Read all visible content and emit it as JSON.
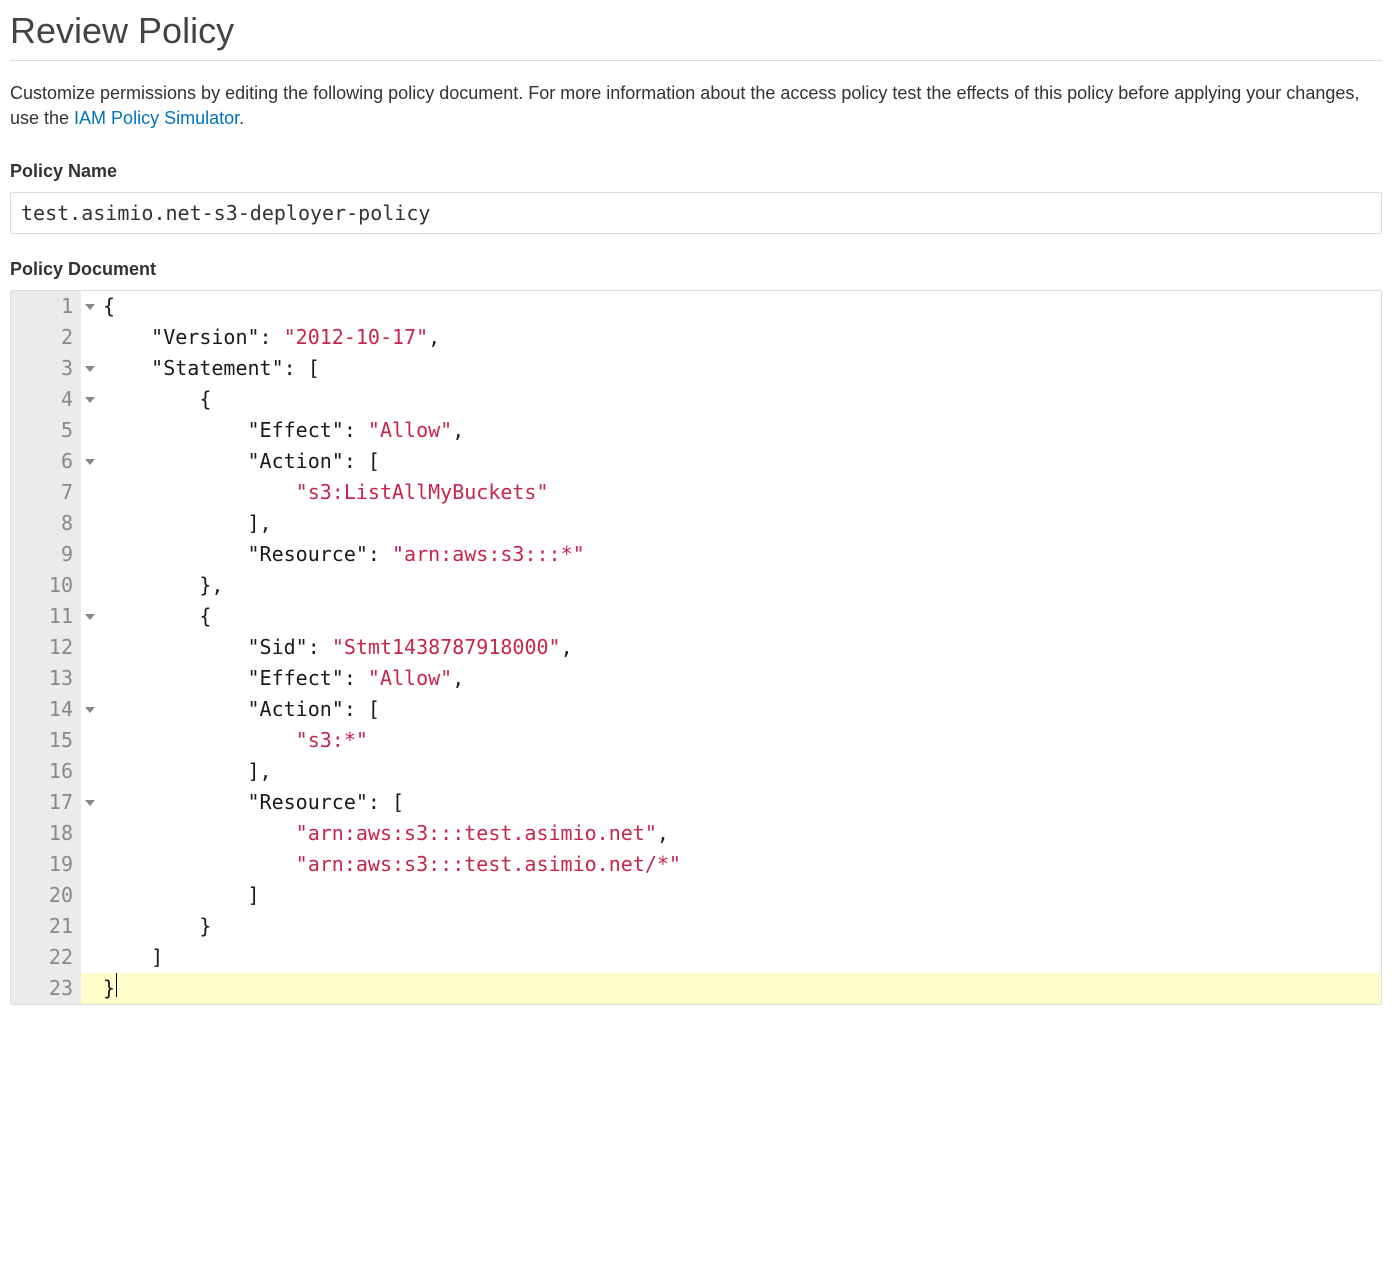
{
  "page": {
    "title": "Review Policy",
    "description_prefix": "Customize permissions by editing the following policy document. For more information about the access policy test the effects of this policy before applying your changes, use the ",
    "description_link_text": "IAM Policy Simulator",
    "description_suffix": "."
  },
  "labels": {
    "policy_name": "Policy Name",
    "policy_document": "Policy Document"
  },
  "form": {
    "policy_name_value": "test.asimio.net-s3-deployer-policy"
  },
  "editor": {
    "lines": [
      {
        "num": "1",
        "fold": true,
        "indent": 0,
        "tokens": [
          {
            "t": "punct",
            "v": "{"
          }
        ]
      },
      {
        "num": "2",
        "fold": false,
        "indent": 0,
        "tokens": [
          {
            "t": "text",
            "v": "    "
          },
          {
            "t": "key",
            "v": "\"Version\""
          },
          {
            "t": "punct",
            "v": ": "
          },
          {
            "t": "string",
            "v": "\"2012-10-17\""
          },
          {
            "t": "punct",
            "v": ","
          }
        ]
      },
      {
        "num": "3",
        "fold": true,
        "indent": 0,
        "tokens": [
          {
            "t": "text",
            "v": "    "
          },
          {
            "t": "key",
            "v": "\"Statement\""
          },
          {
            "t": "punct",
            "v": ": ["
          }
        ]
      },
      {
        "num": "4",
        "fold": true,
        "indent": 0,
        "tokens": [
          {
            "t": "text",
            "v": "        "
          },
          {
            "t": "punct",
            "v": "{"
          }
        ]
      },
      {
        "num": "5",
        "fold": false,
        "indent": 0,
        "tokens": [
          {
            "t": "text",
            "v": "            "
          },
          {
            "t": "key",
            "v": "\"Effect\""
          },
          {
            "t": "punct",
            "v": ": "
          },
          {
            "t": "string",
            "v": "\"Allow\""
          },
          {
            "t": "punct",
            "v": ","
          }
        ]
      },
      {
        "num": "6",
        "fold": true,
        "indent": 0,
        "tokens": [
          {
            "t": "text",
            "v": "            "
          },
          {
            "t": "key",
            "v": "\"Action\""
          },
          {
            "t": "punct",
            "v": ": ["
          }
        ]
      },
      {
        "num": "7",
        "fold": false,
        "indent": 0,
        "tokens": [
          {
            "t": "text",
            "v": "                "
          },
          {
            "t": "string",
            "v": "\"s3:ListAllMyBuckets\""
          }
        ]
      },
      {
        "num": "8",
        "fold": false,
        "indent": 0,
        "tokens": [
          {
            "t": "text",
            "v": "            "
          },
          {
            "t": "punct",
            "v": "],"
          }
        ]
      },
      {
        "num": "9",
        "fold": false,
        "indent": 0,
        "tokens": [
          {
            "t": "text",
            "v": "            "
          },
          {
            "t": "key",
            "v": "\"Resource\""
          },
          {
            "t": "punct",
            "v": ": "
          },
          {
            "t": "string",
            "v": "\"arn:aws:s3:::*\""
          }
        ]
      },
      {
        "num": "10",
        "fold": false,
        "indent": 0,
        "tokens": [
          {
            "t": "text",
            "v": "        "
          },
          {
            "t": "punct",
            "v": "},"
          }
        ]
      },
      {
        "num": "11",
        "fold": true,
        "indent": 0,
        "tokens": [
          {
            "t": "text",
            "v": "        "
          },
          {
            "t": "punct",
            "v": "{"
          }
        ]
      },
      {
        "num": "12",
        "fold": false,
        "indent": 0,
        "tokens": [
          {
            "t": "text",
            "v": "            "
          },
          {
            "t": "key",
            "v": "\"Sid\""
          },
          {
            "t": "punct",
            "v": ": "
          },
          {
            "t": "string",
            "v": "\"Stmt1438787918000\""
          },
          {
            "t": "punct",
            "v": ","
          }
        ]
      },
      {
        "num": "13",
        "fold": false,
        "indent": 0,
        "tokens": [
          {
            "t": "text",
            "v": "            "
          },
          {
            "t": "key",
            "v": "\"Effect\""
          },
          {
            "t": "punct",
            "v": ": "
          },
          {
            "t": "string",
            "v": "\"Allow\""
          },
          {
            "t": "punct",
            "v": ","
          }
        ]
      },
      {
        "num": "14",
        "fold": true,
        "indent": 0,
        "tokens": [
          {
            "t": "text",
            "v": "            "
          },
          {
            "t": "key",
            "v": "\"Action\""
          },
          {
            "t": "punct",
            "v": ": ["
          }
        ]
      },
      {
        "num": "15",
        "fold": false,
        "indent": 0,
        "tokens": [
          {
            "t": "text",
            "v": "                "
          },
          {
            "t": "string",
            "v": "\"s3:*\""
          }
        ]
      },
      {
        "num": "16",
        "fold": false,
        "indent": 0,
        "tokens": [
          {
            "t": "text",
            "v": "            "
          },
          {
            "t": "punct",
            "v": "],"
          }
        ]
      },
      {
        "num": "17",
        "fold": true,
        "indent": 0,
        "tokens": [
          {
            "t": "text",
            "v": "            "
          },
          {
            "t": "key",
            "v": "\"Resource\""
          },
          {
            "t": "punct",
            "v": ": ["
          }
        ]
      },
      {
        "num": "18",
        "fold": false,
        "indent": 0,
        "tokens": [
          {
            "t": "text",
            "v": "                "
          },
          {
            "t": "string",
            "v": "\"arn:aws:s3:::test.asimio.net\""
          },
          {
            "t": "punct",
            "v": ","
          }
        ]
      },
      {
        "num": "19",
        "fold": false,
        "indent": 0,
        "tokens": [
          {
            "t": "text",
            "v": "                "
          },
          {
            "t": "string",
            "v": "\"arn:aws:s3:::test.asimio.net/*\""
          }
        ]
      },
      {
        "num": "20",
        "fold": false,
        "indent": 0,
        "tokens": [
          {
            "t": "text",
            "v": "            "
          },
          {
            "t": "punct",
            "v": "]"
          }
        ]
      },
      {
        "num": "21",
        "fold": false,
        "indent": 0,
        "tokens": [
          {
            "t": "text",
            "v": "        "
          },
          {
            "t": "punct",
            "v": "}"
          }
        ]
      },
      {
        "num": "22",
        "fold": false,
        "indent": 0,
        "tokens": [
          {
            "t": "text",
            "v": "    "
          },
          {
            "t": "punct",
            "v": "]"
          }
        ]
      },
      {
        "num": "23",
        "fold": false,
        "indent": 0,
        "highlight": true,
        "cursor": true,
        "tokens": [
          {
            "t": "punct",
            "v": "}"
          }
        ]
      }
    ]
  }
}
